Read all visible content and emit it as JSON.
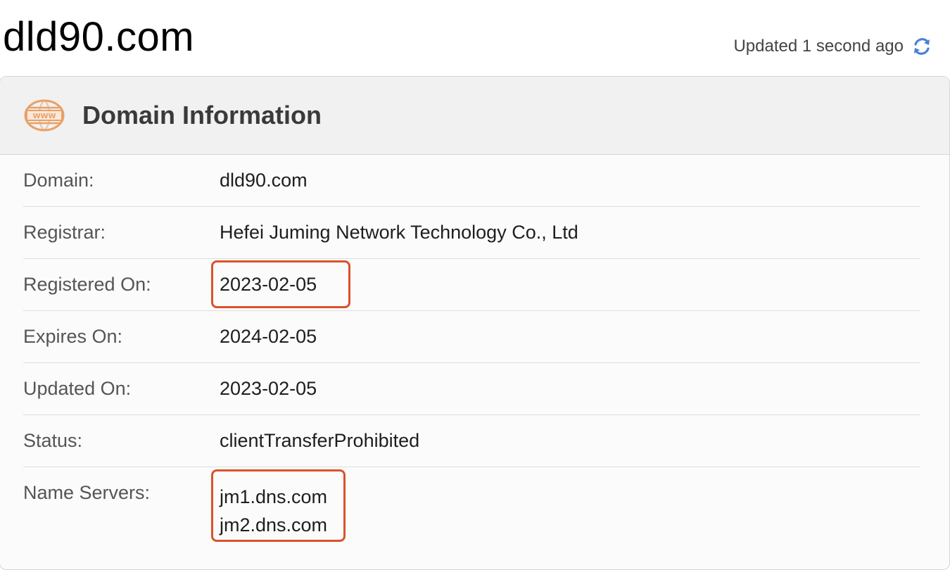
{
  "page": {
    "title": "dld90.com",
    "updated_text": "Updated 1 second ago",
    "refresh_icon": "refresh-icon"
  },
  "card": {
    "title": "Domain Information",
    "icon": "www-icon",
    "icon_color": "#e9a066",
    "rows": [
      {
        "label": "Domain:",
        "value": "dld90.com"
      },
      {
        "label": "Registrar:",
        "value": "Hefei Juming Network Technology Co., Ltd"
      },
      {
        "label": "Registered On:",
        "value": "2023-02-05"
      },
      {
        "label": "Expires On:",
        "value": "2024-02-05"
      },
      {
        "label": "Updated On:",
        "value": "2023-02-05"
      },
      {
        "label": "Status:",
        "value": "clientTransferProhibited"
      }
    ],
    "name_servers": {
      "label": "Name Servers:",
      "values": [
        "jm1.dns.com",
        "jm2.dns.com"
      ]
    }
  },
  "colors": {
    "highlight": "#d9532c",
    "refresh": "#4a7fd8"
  }
}
